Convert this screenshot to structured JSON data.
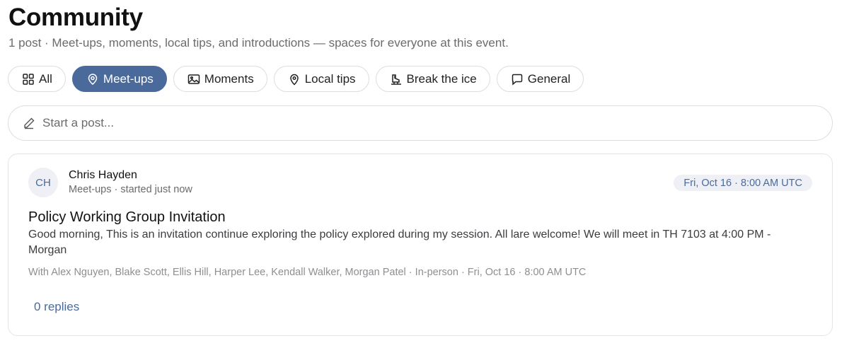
{
  "header": {
    "title": "Community",
    "subtitle": "1 post · Meet-ups, moments, local tips, and introductions — spaces for everyone at this event."
  },
  "filters": [
    {
      "label": "All",
      "icon": "grid-icon",
      "active": false
    },
    {
      "label": "Meet-ups",
      "icon": "location-pin-icon",
      "active": true
    },
    {
      "label": "Moments",
      "icon": "image-icon",
      "active": false
    },
    {
      "label": "Local tips",
      "icon": "map-pin-icon",
      "active": false
    },
    {
      "label": "Break the ice",
      "icon": "ice-skate-icon",
      "active": false
    },
    {
      "label": "General",
      "icon": "chat-bubble-icon",
      "active": false
    }
  ],
  "composer": {
    "placeholder": "Start a post...",
    "icon": "pencil-icon"
  },
  "post": {
    "avatar_initials": "CH",
    "author": "Chris Hayden",
    "meta": "Meet-ups · started just now",
    "date_badge": "Fri, Oct 16 · 8:00 AM UTC",
    "title": "Policy Working Group Invitation",
    "body": "Good morning, This is an invitation continue exploring the policy explored during my session. All lare welcome! We will meet in TH 7103 at 4:00 PM - Morgan",
    "details": "With Alex Nguyen, Blake Scott, Ellis Hill, Harper Lee, Kendall Walker, Morgan Patel · In-person · Fri, Oct 16 · 8:00 AM UTC",
    "replies": "0 replies"
  },
  "colors": {
    "accent": "#4a6a9c",
    "border": "#dcdde1",
    "muted_text": "#6b6b6f",
    "badge_bg": "#eef0f5"
  }
}
